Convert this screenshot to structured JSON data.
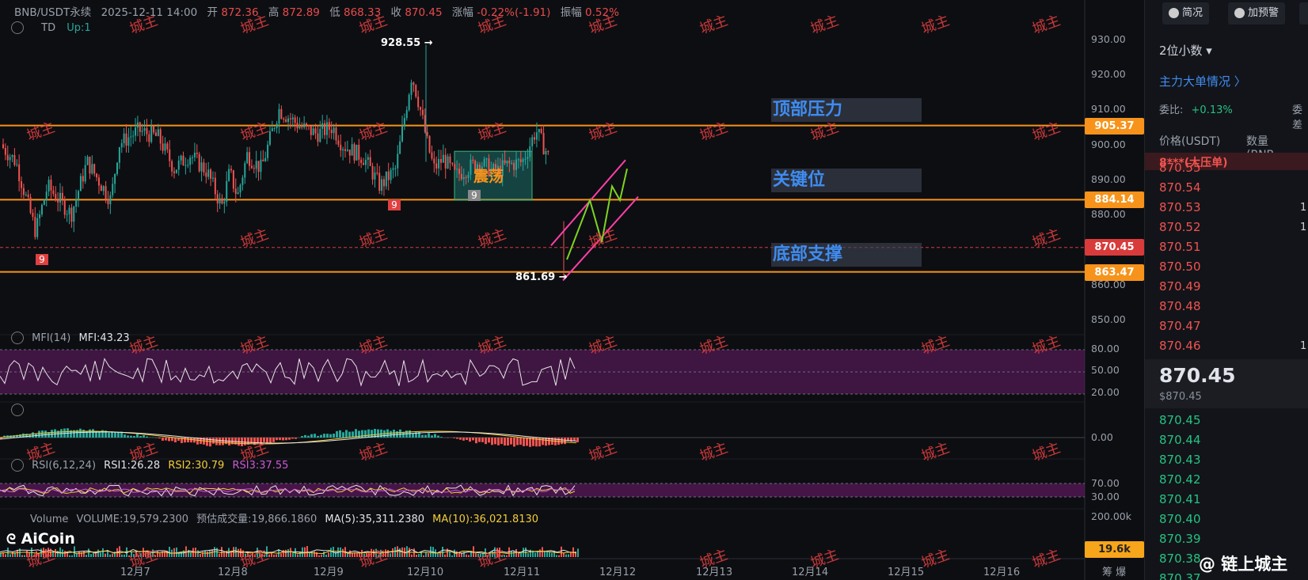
{
  "header": {
    "symbol": "BNB/USDT永续",
    "datetime": "2025-12-11 14:00",
    "open_label": "开",
    "open": "872.36",
    "high_label": "高",
    "high": "872.89",
    "low_label": "低",
    "low": "868.33",
    "close_label": "收",
    "close": "870.45",
    "change_label": "涨幅",
    "change": "-0.22%(-1.91)",
    "amp_label": "振幅",
    "amp": "0.52%"
  },
  "indicator": {
    "name": "TD",
    "up_label": "Up:1"
  },
  "annotations": {
    "high_point": "928.55 →",
    "low_point": "861.69 →",
    "range_box": "震荡",
    "td_counts": [
      "9",
      "9",
      "9"
    ],
    "zones": [
      "顶部压力",
      "关键位",
      "底部支撑"
    ]
  },
  "price_axis": [
    "930.00",
    "920.00",
    "910.00",
    "900.00",
    "890.00",
    "880.00",
    "860.00",
    "850.00"
  ],
  "price_labels": {
    "resistance": "905.37",
    "key": "884.14",
    "current": "870.45",
    "support": "863.47"
  },
  "mfi": {
    "title": "MFI(14)",
    "value": "MFI:43.23",
    "ticks": [
      "80.00",
      "50.00",
      "20.00"
    ]
  },
  "macd": {
    "zero": "0.00"
  },
  "rsi": {
    "title": "RSI(6,12,24)",
    "rsi1": "RSI1:26.28",
    "rsi2": "RSI2:30.79",
    "rsi3": "RSI3:37.55",
    "ticks": [
      "70.00",
      "30.00"
    ]
  },
  "volume": {
    "title": "Volume",
    "value": "VOLUME:19,579.2300",
    "est": "预估成交量:19,866.1860",
    "ma5": "MA(5):35,311.2380",
    "ma10": "MA(10):36,021.8130",
    "axis_top": "200.00k",
    "current": "19.6k"
  },
  "x_axis": [
    "12月7",
    "12月8",
    "12月9",
    "12月10",
    "12月11",
    "12月12",
    "12月13",
    "12月14",
    "12月15",
    "12月16"
  ],
  "x_right": "筹 爆",
  "watermark": "城主",
  "logo": "AiCoin",
  "brand": "@ 链上城主",
  "sidebar": {
    "btn_brief": "简况",
    "btn_alert": "加预警",
    "decimals": "2位小数 ▾",
    "big_orders": "主力大单情况 〉",
    "ratio_label": "委比:",
    "ratio_value": "+0.13%",
    "ratio_label2": "委差",
    "col_price": "价格(USDT)",
    "col_qty": "数量 (BNB",
    "big_sell": "8***(大压单)",
    "asks": [
      "870.55",
      "870.54",
      "870.53",
      "870.52",
      "870.51",
      "870.50",
      "870.49",
      "870.48",
      "870.47",
      "870.46"
    ],
    "ask_qty": [
      "",
      "",
      "1",
      "1",
      "",
      "",
      "",
      "",
      "",
      "1"
    ],
    "last_price": "870.45",
    "last_usd": "$870.45",
    "bids": [
      "870.45",
      "870.44",
      "870.43",
      "870.42",
      "870.41",
      "870.40",
      "870.39",
      "870.38",
      "870.37"
    ]
  },
  "colors": {
    "up": "#26a69a",
    "down": "#ef5350",
    "orange": "#f7931a",
    "accent": "#3f8cf0",
    "pink": "#ff3fa8",
    "green_line": "#7ed321"
  }
}
